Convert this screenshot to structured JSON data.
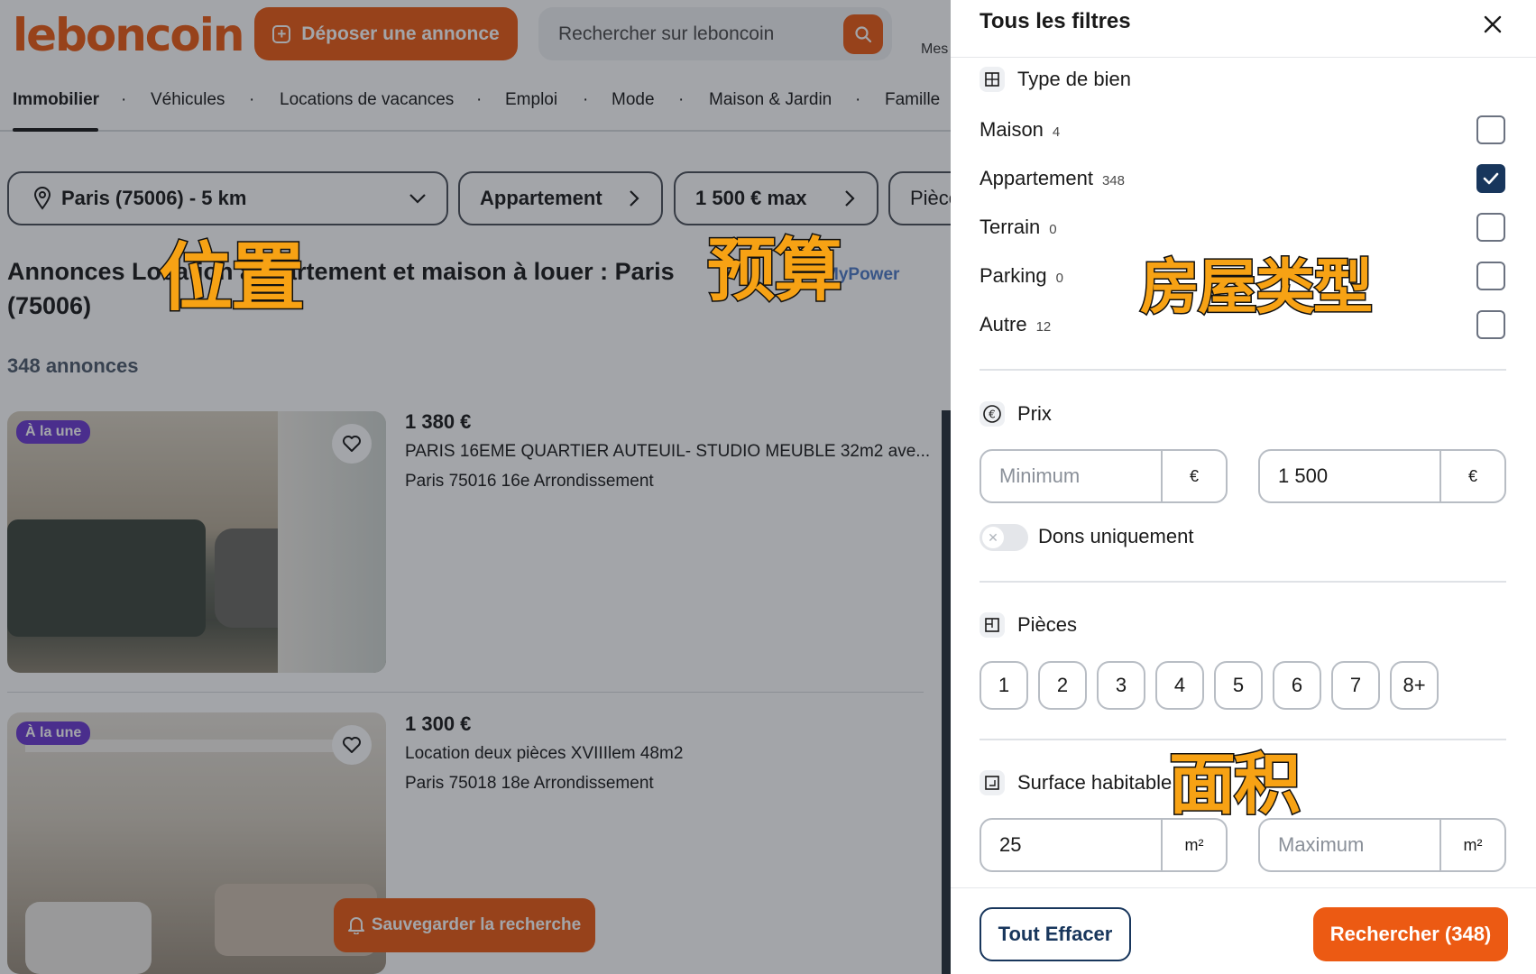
{
  "header": {
    "logo": "leboncoin",
    "deposit_label": "Déposer une annonce",
    "search_placeholder": "Rechercher sur leboncoin",
    "mes_label": "Mes"
  },
  "nav": {
    "items": [
      {
        "label": "Immobilier",
        "active": true
      },
      {
        "label": "Véhicules"
      },
      {
        "label": "Locations de vacances"
      },
      {
        "label": "Emploi"
      },
      {
        "label": "Mode"
      },
      {
        "label": "Maison & Jardin"
      },
      {
        "label": "Famille"
      }
    ],
    "separator": "·"
  },
  "filters_bar": {
    "location": "Paris (75006) - 5 km",
    "type": "Appartement",
    "price": "1 500 € max",
    "rooms": "Pièce"
  },
  "results": {
    "title": "Annonces Location appartement et maison à louer : Paris (75006)",
    "mypower": "MyPower",
    "count": "348 annonces"
  },
  "listings": [
    {
      "badge": "À la une",
      "price": "1 380 €",
      "title": "PARIS 16EME QUARTIER AUTEUIL- STUDIO MEUBLE 32m2 ave...",
      "location": "Paris 75016 16e Arrondissement"
    },
    {
      "badge": "À la une",
      "price": "1 300 €",
      "title": "Location deux pièces XVIIIlem 48m2",
      "location": "Paris 75018 18e Arrondissement"
    }
  ],
  "save_search_label": "Sauvegarder la recherche",
  "panel": {
    "title": "Tous les filtres",
    "type_section": {
      "title": "Type de bien",
      "options": [
        {
          "label": "Maison",
          "count": "4",
          "checked": false
        },
        {
          "label": "Appartement",
          "count": "348",
          "checked": true
        },
        {
          "label": "Terrain",
          "count": "0",
          "checked": false
        },
        {
          "label": "Parking",
          "count": "0",
          "checked": false
        },
        {
          "label": "Autre",
          "count": "12",
          "checked": false
        }
      ]
    },
    "price_section": {
      "title": "Prix",
      "min_placeholder": "Minimum",
      "max_value": "1 500",
      "unit": "€",
      "toggle_label": "Dons uniquement"
    },
    "rooms_section": {
      "title": "Pièces",
      "options": [
        "1",
        "2",
        "3",
        "4",
        "5",
        "6",
        "7",
        "8+"
      ]
    },
    "surface_section": {
      "title": "Surface habitable",
      "min_value": "25",
      "max_placeholder": "Maximum",
      "unit": "m²"
    },
    "clear_label": "Tout Effacer",
    "search_label": "Rechercher (348)"
  },
  "annotations": {
    "location": "位置",
    "budget": "预算",
    "house_type": "房屋类型",
    "area": "面积"
  },
  "colors": {
    "brand": "#ec5a13",
    "navy": "#18365c",
    "badge": "#6c3ad1",
    "annotation": "#f7a214"
  }
}
